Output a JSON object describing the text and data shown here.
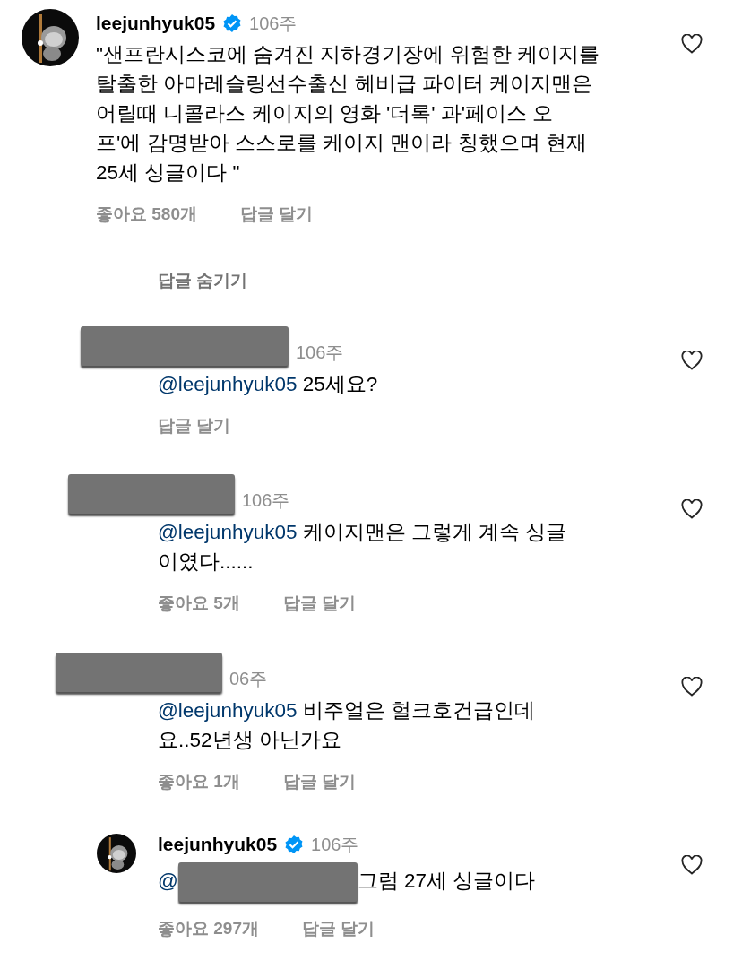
{
  "comment": {
    "author": "leejunhyuk05",
    "verified": true,
    "time": "106주",
    "lines": [
      "\"샌프란시스코에 숨겨진 지하경기장에 위험한 케이지를",
      "탈출한 아마레슬링선수출신 헤비급 파이터 케이지맨은",
      "어릴때 니콜라스 케이지의 영화 '더록' 과'페이스 오",
      "프'에 감명받아 스스로를 케이지 맨이라 칭했으며 현재",
      "25세 싱글이다 \""
    ],
    "likes": "좋아요 580개",
    "reply_label": "답글 달기"
  },
  "hide_replies": "답글 숨기기",
  "replies": [
    {
      "kind": "redacted",
      "time": "106주",
      "mention": "@leejunhyuk05",
      "lines": [
        "25세요?"
      ],
      "reply_label": "답글 달기"
    },
    {
      "kind": "redacted",
      "time": "106주",
      "mention": "@leejunhyuk05",
      "lines": [
        "케이지맨은 그렇게 계속 싱글",
        "이였다......"
      ],
      "likes": "좋아요 5개",
      "reply_label": "답글 달기"
    },
    {
      "kind": "redacted",
      "time": "06주",
      "mention": "@leejunhyuk05",
      "lines": [
        "비주얼은 헐크호건급인데",
        "요..52년생 아닌가요"
      ],
      "likes": "좋아요 1개",
      "reply_label": "답글 달기"
    },
    {
      "kind": "author",
      "author": "leejunhyuk05",
      "verified": true,
      "time": "106주",
      "mention": "@",
      "mention_redacted": true,
      "lines": [
        "그럼 27세 싱글이다"
      ],
      "likes": "좋아요 297개",
      "reply_label": "답글 달기"
    }
  ]
}
